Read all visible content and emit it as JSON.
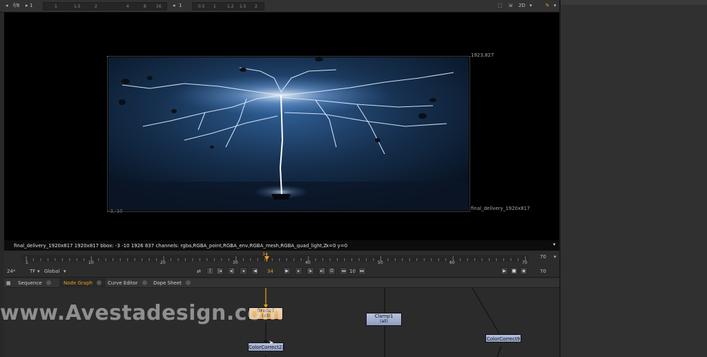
{
  "viewer_toolbar": {
    "fstop": "f/8",
    "frame_value": "1",
    "gain_scale": [
      "1",
      "1.5",
      "2",
      "4",
      "8",
      "16"
    ],
    "gamma_value": "1",
    "gamma_scale": [
      "0.5",
      "1",
      "1.2",
      "1.5",
      "2"
    ],
    "view_mode": "2D"
  },
  "viewer": {
    "top_right_coord": "1923,827",
    "bottom_left_coord": "-3,-10",
    "format_label": "final_delivery_1920x817"
  },
  "info_bar": {
    "text": "final_delivery_1920x817 1920x817  bbox: -3 -10 1926 837 channels: rgba,RGBA_point,RGBA_env,RGBA_mesh,RGBA_quad_light,Z",
    "coords": "x=0 y=0"
  },
  "timeline": {
    "ticks": [
      "1",
      "10",
      "20",
      "30",
      "40",
      "50",
      "60",
      "70"
    ],
    "current_frame_marker": "34",
    "end_frame": "70"
  },
  "playback": {
    "fps": "24*",
    "tf": "TF",
    "range_mode": "Global",
    "current_frame": "34",
    "increment": "10",
    "end_frame": "70"
  },
  "tabs": [
    {
      "label": "Sequence",
      "active": false
    },
    {
      "label": "Node Graph",
      "active": true
    },
    {
      "label": "Curve Editor",
      "active": false
    },
    {
      "label": "Dope Sheet",
      "active": false
    }
  ],
  "nodes": {
    "grade": {
      "label": "Grade1",
      "sub": "(all)"
    },
    "clamp": {
      "label": "Clamp1",
      "sub": "(all)"
    },
    "colorcorrect_a": {
      "label": "ColorCorrect23"
    },
    "colorcorrect_b": {
      "label": "ColorCorrect9"
    }
  },
  "watermark": "www.Avestadesign.com",
  "colors": {
    "accent_orange": "#f0a020",
    "node_blue": "#9aa8cc",
    "node_orange": "#eab06a"
  }
}
